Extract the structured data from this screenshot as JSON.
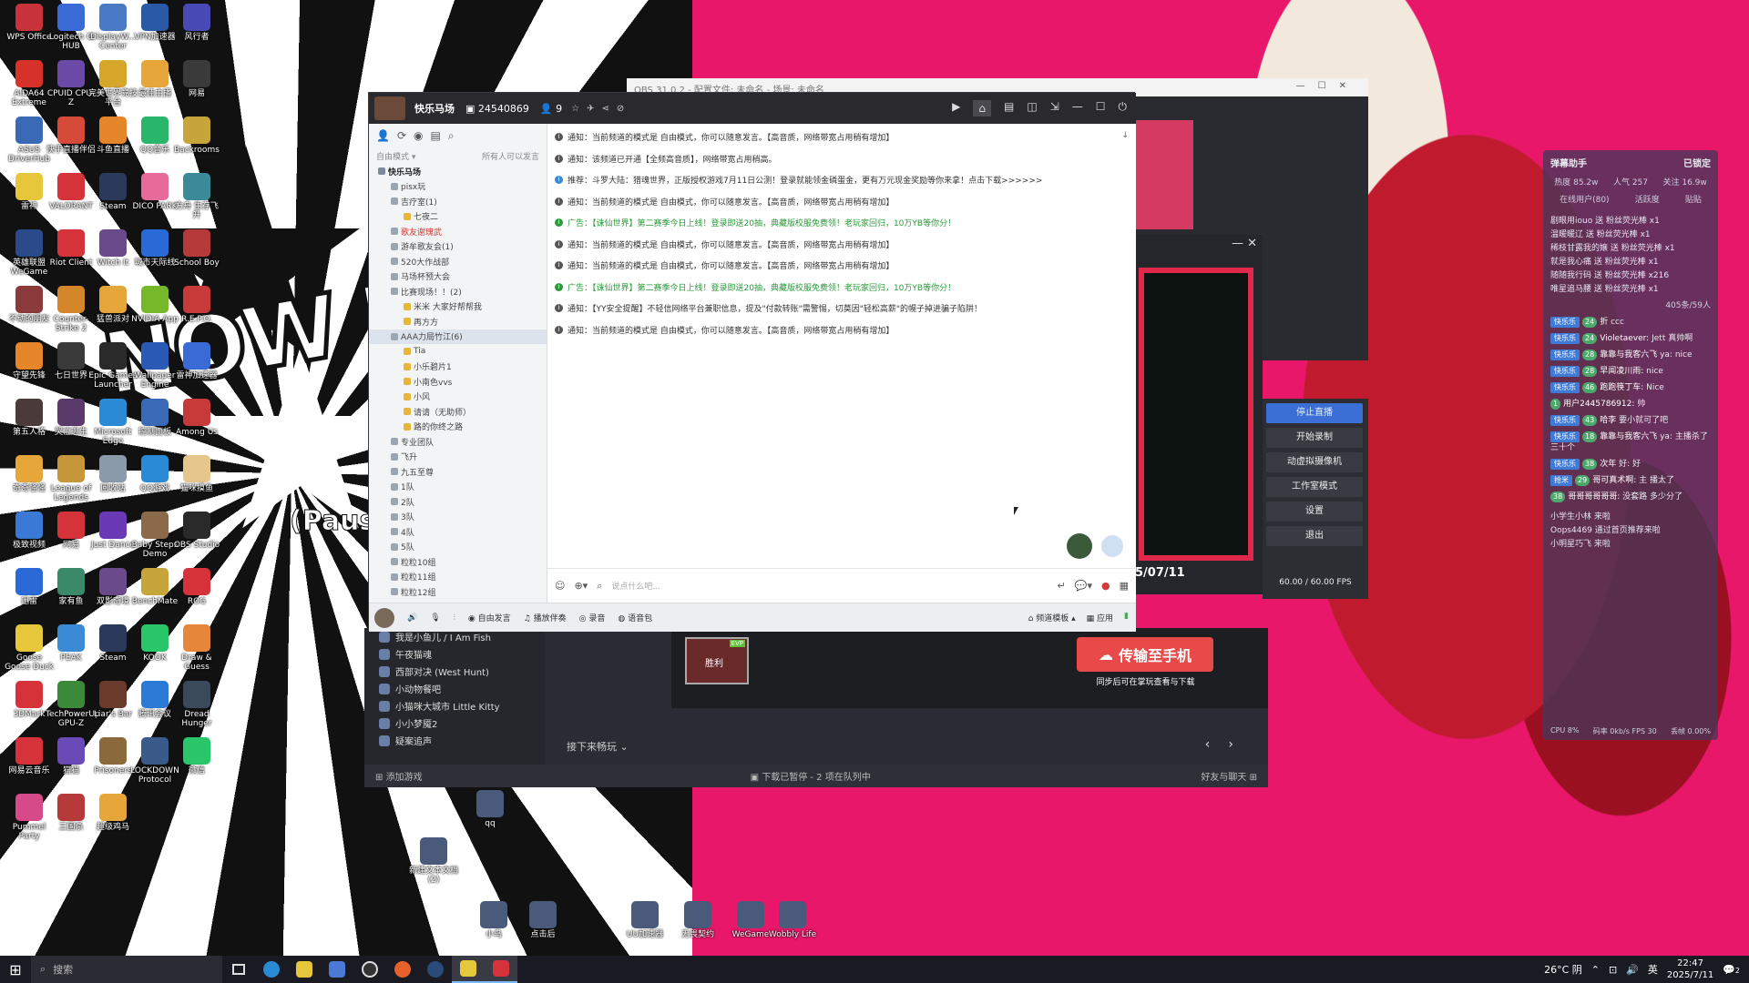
{
  "wallpaper": {
    "now_playing": "NOW PLAYIN",
    "paused": "(Paus"
  },
  "desktop_icons": [
    {
      "label": "WPS Office",
      "color": "#c8323a"
    },
    {
      "label": "Logitech G HUB",
      "color": "#3a6ad6"
    },
    {
      "label": "DisplayW... Center",
      "color": "#4a7ac6"
    },
    {
      "label": "VPN加速器",
      "color": "#2a5aa6"
    },
    {
      "label": "风行者",
      "color": "#4a4ab6"
    },
    {
      "label": "AIDA64 Extreme",
      "color": "#d6322a"
    },
    {
      "label": "CPUID CPU-Z",
      "color": "#6a4aa6"
    },
    {
      "label": "完美世界竞技平台",
      "color": "#d6a62a"
    },
    {
      "label": "最佳主播",
      "color": "#e6a63a"
    },
    {
      "label": "网易",
      "color": "#3a3a3a"
    },
    {
      "label": "ASUS DriverHub",
      "color": "#3a6ab6"
    },
    {
      "label": "快手直播伴侣",
      "color": "#d64a3a"
    },
    {
      "label": "斗鱼直播",
      "color": "#e6862a"
    },
    {
      "label": "QQ音乐",
      "color": "#2ab66a"
    },
    {
      "label": "Backrooms",
      "color": "#c6a63a"
    },
    {
      "label": "雷神",
      "color": "#e6c63a"
    },
    {
      "label": "VALORANT",
      "color": "#d6323a"
    },
    {
      "label": "Steam",
      "color": "#2a3a5a"
    },
    {
      "label": "DICO PARK",
      "color": "#e66a9a"
    },
    {
      "label": "方舟 生存飞升",
      "color": "#3a8a9a"
    },
    {
      "label": "英雄联盟WeGame",
      "color": "#2a4a8a"
    },
    {
      "label": "Riot Client",
      "color": "#d6323a"
    },
    {
      "label": "Witch It",
      "color": "#6a4a8a"
    },
    {
      "label": "城市天际线",
      "color": "#2a6ad6"
    },
    {
      "label": "School Boy",
      "color": "#b63a3a"
    },
    {
      "label": "不动的朋友",
      "color": "#8a3a3a"
    },
    {
      "label": "Counter-Strike 2",
      "color": "#d6862a"
    },
    {
      "label": "猛兽派对",
      "color": "#e6a63a"
    },
    {
      "label": "NVIDIA App",
      "color": "#76b82a"
    },
    {
      "label": "R.E.P.O.",
      "color": "#c63a3a"
    },
    {
      "label": "守望先锋",
      "color": "#e6862a"
    },
    {
      "label": "七日世界",
      "color": "#3a3a3a"
    },
    {
      "label": "Epic Games Launcher",
      "color": "#2a2a2a"
    },
    {
      "label": "Wallpaper Engine",
      "color": "#2a5ab6"
    },
    {
      "label": "雷神加速器",
      "color": "#3a6ad6"
    },
    {
      "label": "第五人格",
      "color": "#4a3a3a"
    },
    {
      "label": "哭泣逃生",
      "color": "#5a3a6a"
    },
    {
      "label": "Microsoft Edge",
      "color": "#2a8ad6"
    },
    {
      "label": "控制面板",
      "color": "#3a6ab6"
    },
    {
      "label": "Among Us",
      "color": "#c63a3a"
    },
    {
      "label": "奇奇怪怪",
      "color": "#e6a63a"
    },
    {
      "label": "League of Legends",
      "color": "#c6963a"
    },
    {
      "label": "回收站",
      "color": "#8a9aaa"
    },
    {
      "label": "QQ游戏",
      "color": "#2a8ad6"
    },
    {
      "label": "猫咪摸鱼",
      "color": "#e6c68a"
    },
    {
      "label": "极致视频",
      "color": "#3a7ad6"
    },
    {
      "label": "网易",
      "color": "#d6323a"
    },
    {
      "label": "Just Dance",
      "color": "#6a3ab6"
    },
    {
      "label": "Baby Steps Demo",
      "color": "#8a6a4a"
    },
    {
      "label": "OBS Studio",
      "color": "#2a2a2a"
    },
    {
      "label": "迅雷",
      "color": "#2a6ad6"
    },
    {
      "label": "家有鱼",
      "color": "#3a8a6a"
    },
    {
      "label": "双影奇境",
      "color": "#6a4a8a"
    },
    {
      "label": "BenchMate",
      "color": "#c6a63a"
    },
    {
      "label": "ROG",
      "color": "#d6323a"
    },
    {
      "label": "Goose Goose Duck",
      "color": "#e6c63a"
    },
    {
      "label": "PEAK",
      "color": "#3a8ad6"
    },
    {
      "label": "Steam",
      "color": "#2a3a5a"
    },
    {
      "label": "KOOK",
      "color": "#2ac66a"
    },
    {
      "label": "Draw & Guess",
      "color": "#e6863a"
    },
    {
      "label": "3DMark",
      "color": "#d6323a"
    },
    {
      "label": "TechPowerUp GPU-Z",
      "color": "#3a8a3a"
    },
    {
      "label": "Liar's Bar",
      "color": "#6a3a2a"
    },
    {
      "label": "腾讯会议",
      "color": "#2a7ad6"
    },
    {
      "label": "Dread Hunger",
      "color": "#3a4a5a"
    },
    {
      "label": "网易云音乐",
      "color": "#d6323a"
    },
    {
      "label": "猫猫",
      "color": "#6a4ab6"
    },
    {
      "label": "Prisoners",
      "color": "#8a6a3a"
    },
    {
      "label": "LOCKDOWN Protocol",
      "color": "#3a5a8a"
    },
    {
      "label": "微信",
      "color": "#2ac66a"
    },
    {
      "label": "Pummel Party",
      "color": "#d64a8a"
    },
    {
      "label": "三国杀",
      "color": "#b63a3a"
    },
    {
      "label": "超级鸡马",
      "color": "#e6a63a"
    }
  ],
  "desktop_bottom_icons": [
    {
      "label": "新建文本文档 (2)"
    },
    {
      "label": "qq"
    },
    {
      "label": "小鸟"
    },
    {
      "label": "点击后"
    },
    {
      "label": "UU加速器"
    },
    {
      "label": "无畏契约"
    },
    {
      "label": "WeGame"
    },
    {
      "label": "Wobbly Life"
    }
  ],
  "taskbar": {
    "search_placeholder": "搜索",
    "weather": "26°C 阴",
    "ime": "英",
    "time": "22:47",
    "date": "2025/7/11",
    "notifications": "2"
  },
  "obs": {
    "title": "OBS 31.0.2 - 配置文件: 未命名 - 场景: 未命名",
    "date_overlay": "5/07/11",
    "buttons": [
      "停止直播",
      "开始录制",
      "动虚拟摄像机",
      "工作室模式",
      "设置",
      "退出"
    ],
    "fps": "60.00 / 60.00 FPS"
  },
  "assistant": {
    "title": "弹幕助手",
    "lock": "已锁定",
    "heat": "热度 85.2w",
    "popularity": "人气 257",
    "income": "关注 16.9w",
    "tab_online": "在线用户(80)",
    "tab_rank": "活跃度",
    "tab_gift": "贴贴",
    "gifts": [
      "剧眼用iouo 送 粉丝荧光棒 x1",
      "温暖暖辽 送 粉丝荧光棒 x1",
      "稀枝甘露我的嬢 送 粉丝荧光棒 x1",
      "就是我心痛 送 粉丝荧光棒 x1",
      "随随我行码 送 粉丝荧光棒 x216",
      "唯星追马腰 送 粉丝荧光棒 x1"
    ],
    "viewer_count": "405条/59人",
    "messages": [
      {
        "badge": "快乐乐",
        "lvl": "24",
        "user": "折",
        "text": "ccc"
      },
      {
        "badge": "快乐乐",
        "lvl": "24",
        "user": "Violetaever:",
        "text": "Jett 真帅啊"
      },
      {
        "badge": "快乐乐",
        "lvl": "28",
        "user": "靠靠与我客六飞",
        "text": "ya: nice"
      },
      {
        "badge": "快乐乐",
        "lvl": "28",
        "user": "早闻凌川雨:",
        "text": "nice"
      },
      {
        "badge": "快乐乐",
        "lvl": "46",
        "user": "跑跑筷丁车:",
        "text": "Nice"
      },
      {
        "badge": "",
        "lvl": "1",
        "user": "用户2445786912:",
        "text": "帅"
      },
      {
        "badge": "快乐乐",
        "lvl": "43",
        "user": "哈李",
        "text": "要小就可了吧"
      },
      {
        "badge": "快乐乐",
        "lvl": "18",
        "user": "靠靠与我客六飞",
        "text": "ya: 主播杀了三十个"
      },
      {
        "badge": "快乐乐",
        "lvl": "38",
        "user": "次年",
        "text": "好: 好"
      },
      {
        "badge": "抢米",
        "lvl": "29",
        "user": "哥可真术啊:",
        "text": "主 播太了"
      },
      {
        "badge": "",
        "lvl": "38",
        "user": "哥哥哥哥哥哥:",
        "text": "没套路 多少分了"
      }
    ],
    "system": [
      "小学生小林 来啦",
      "Oops4469 通过首页推荐来啦",
      "小明星巧飞 来啦"
    ],
    "footer_cpu": "CPU 8%",
    "footer_rate": "码率 0kb/s FPS 30",
    "footer_drop": "丢帧 0.00%"
  },
  "yy": {
    "channel_name": "快乐马场",
    "channel_id": "24540869",
    "user_count": "9",
    "free_mode": "自由模式",
    "all_can_speak": "所有人可以发言",
    "tree": [
      {
        "text": "快乐马场",
        "level": 0,
        "style": "bold"
      },
      {
        "text": "pisx玩",
        "level": 1,
        "style": ""
      },
      {
        "text": "吉疗室(1)",
        "level": 1,
        "style": ""
      },
      {
        "text": "七夜二",
        "level": 2,
        "style": ""
      },
      {
        "text": "歌友谢瑰武",
        "level": 1,
        "style": "red"
      },
      {
        "text": "游牟歌友会(1)",
        "level": 1,
        "style": ""
      },
      {
        "text": "520大作战部",
        "level": 1,
        "style": ""
      },
      {
        "text": "马场杯预大会",
        "level": 1,
        "style": ""
      },
      {
        "text": "比赛现场！！(2)",
        "level": 1,
        "style": ""
      },
      {
        "text": "米米 大家好帮帮我",
        "level": 2,
        "style": ""
      },
      {
        "text": "再方方",
        "level": 2,
        "style": ""
      },
      {
        "text": "AAA力局竹江(6)",
        "level": 1,
        "style": "sel"
      },
      {
        "text": "Tia",
        "level": 2,
        "style": ""
      },
      {
        "text": "小乐碧片1",
        "level": 2,
        "style": ""
      },
      {
        "text": "小南色vvs",
        "level": 2,
        "style": ""
      },
      {
        "text": "小风",
        "level": 2,
        "style": ""
      },
      {
        "text": "请请（无助师）",
        "level": 2,
        "style": ""
      },
      {
        "text": "路的你终之路",
        "level": 2,
        "style": ""
      },
      {
        "text": "专业团队",
        "level": 1,
        "style": ""
      },
      {
        "text": "飞升",
        "level": 1,
        "style": ""
      },
      {
        "text": "九五至尊",
        "level": 1,
        "style": ""
      },
      {
        "text": "1队",
        "level": 1,
        "style": ""
      },
      {
        "text": "2队",
        "level": 1,
        "style": ""
      },
      {
        "text": "3队",
        "level": 1,
        "style": ""
      },
      {
        "text": "4队",
        "level": 1,
        "style": ""
      },
      {
        "text": "5队",
        "level": 1,
        "style": ""
      },
      {
        "text": "粒粒10组",
        "level": 1,
        "style": ""
      },
      {
        "text": "粒粒11组",
        "level": 1,
        "style": ""
      },
      {
        "text": "粒粒12组",
        "level": 1,
        "style": ""
      }
    ],
    "chat": [
      {
        "type": "notice",
        "text": "通知：当前频道的模式是 自由模式，你可以随意发言。【高音质，网络带宽占用稍有增加】"
      },
      {
        "type": "notice",
        "text": "通知：该频道已开通【全频高音质】，网络带宽占用稍高。"
      },
      {
        "type": "rec",
        "text": "推荐：斗罗大陆：猎魂世界，正版授权游戏7月11日公测！登录就能领金磷蛋金，更有万元现金奖励等你来拿！点击下载>>>>>>"
      },
      {
        "type": "notice",
        "text": "通知：当前频道的模式是 自由模式，你可以随意发言。【高音质，网络带宽占用稍有增加】"
      },
      {
        "type": "ad",
        "text": "广告：【诛仙世界】第二赛季今日上线！登录即送20抽，典藏版校服免费领！老玩家回归，10万YB等你分！"
      },
      {
        "type": "notice",
        "text": "通知：当前频道的模式是 自由模式，你可以随意发言。【高音质，网络带宽占用稍有增加】"
      },
      {
        "type": "notice",
        "text": "通知：当前频道的模式是 自由模式，你可以随意发言。【高音质，网络带宽占用稍有增加】"
      },
      {
        "type": "ad",
        "text": "广告：【诛仙世界】第二赛季今日上线！登录即送20抽，典藏版校服免费领！老玩家回归，10万YB等你分！"
      },
      {
        "type": "notice",
        "text": "通知：【YY安全提醒】不轻信网络平台兼职信息，提及\"付款转账\"需警惕，切莫因\"轻松高薪\"的幌子掉进骗子陷阱！"
      },
      {
        "type": "notice",
        "text": "通知：当前频道的模式是 自由模式，你可以随意发言。【高音质，网络带宽占用稍有增加】"
      }
    ],
    "input_placeholder": "说点什么吧...",
    "bottom_free": "自由发言",
    "bottom_accompany": "播放伴奏",
    "bottom_record": "录音",
    "bottom_voice": "语音包",
    "bottom_channel_template": "频道模板",
    "bottom_app": "应用"
  },
  "yy_back": {
    "games": [
      "我是小鱼儿 / I Am Fish",
      "午夜猫魂",
      "西部对决 (West Hunt)",
      "小动物餐吧",
      "小猫咪大城市 Little Kitty",
      "小小梦魇2",
      "疑案追声"
    ],
    "thumb_badge": "EVP",
    "thumb_label": "胜利",
    "mobile_button": "传输至手机",
    "mobile_sub": "同步后可在掌玩查看与下载",
    "next_label": "接下来畅玩",
    "add_game": "添加游戏",
    "download_status": "下载已暂停 - 2 项在队列中",
    "friends": "好友与聊天"
  }
}
